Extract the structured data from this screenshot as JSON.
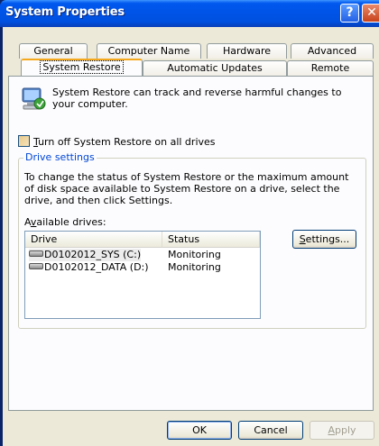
{
  "window": {
    "title": "System Properties",
    "help_glyph": "?",
    "close_glyph": "✕"
  },
  "tabs": {
    "row1": [
      {
        "label": "General"
      },
      {
        "label": "Computer Name"
      },
      {
        "label": "Hardware"
      },
      {
        "label": "Advanced"
      }
    ],
    "row2": [
      {
        "label": "System Restore",
        "active": true
      },
      {
        "label": "Automatic Updates"
      },
      {
        "label": "Remote"
      }
    ]
  },
  "panel": {
    "intro_text": "System Restore can track and reverse harmful changes to your computer.",
    "turn_off_label_prefix": "T",
    "turn_off_label_rest": "urn off System Restore on all drives",
    "turn_off_checked": false,
    "drive_settings": {
      "legend": "Drive settings",
      "description": "To change the status of System Restore or the maximum amount of disk space available to System Restore on a drive, select the drive, and then click Settings.",
      "available_prefix": "A",
      "available_u": "v",
      "available_rest": "ailable drives:",
      "columns": [
        "Drive",
        "Status"
      ],
      "drives": [
        {
          "name": "D0102012_SYS (C:)",
          "status": "Monitoring"
        },
        {
          "name": "D0102012_DATA (D:)",
          "status": "Monitoring"
        }
      ],
      "settings_u": "S",
      "settings_rest": "ettings..."
    }
  },
  "buttons": {
    "ok": "OK",
    "cancel": "Cancel",
    "apply_u": "A",
    "apply_rest": "pply"
  },
  "colors": {
    "titlebar": "#0058ee",
    "client": "#ece9d8",
    "group_legend": "#0046d5",
    "active_tab_accent": "#f5a81c"
  }
}
